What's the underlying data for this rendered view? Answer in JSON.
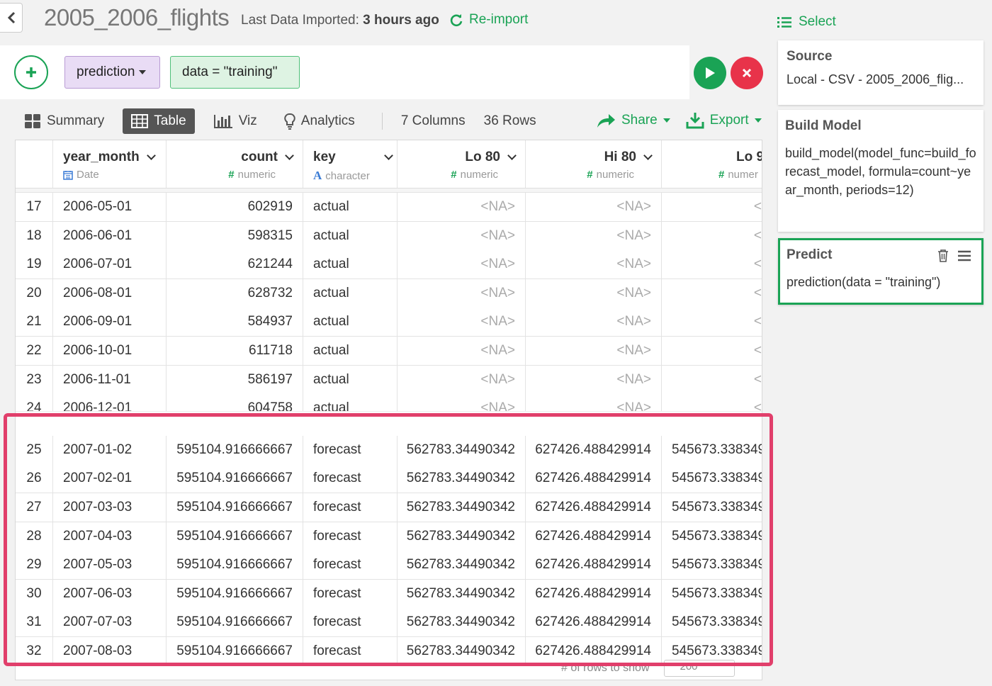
{
  "header": {
    "title": "2005_2006_flights",
    "last_imported_label": "Last Data Imported:",
    "last_imported_value": "3 hours ago",
    "reimport_label": "Re-import"
  },
  "step": {
    "function_token": "prediction",
    "argument_token": "data = \"training\""
  },
  "tabs": [
    {
      "label": "Summary"
    },
    {
      "label": "Table"
    },
    {
      "label": "Viz"
    },
    {
      "label": "Analytics"
    }
  ],
  "table_info": {
    "columns": "7 Columns",
    "rows": "36 Rows"
  },
  "actions": {
    "share": "Share",
    "export": "Export"
  },
  "table": {
    "columns": [
      {
        "name": "year_month",
        "type": "Date"
      },
      {
        "name": "count",
        "type": "numeric"
      },
      {
        "name": "key",
        "type": "character"
      },
      {
        "name": "Lo 80",
        "type": "numeric"
      },
      {
        "name": "Hi 80",
        "type": "numeric"
      },
      {
        "name": "Lo 9",
        "type": "numer"
      }
    ],
    "rows": [
      [
        "17",
        "2006-05-01",
        "602919",
        "actual",
        "<NA>",
        "<NA>",
        "<"
      ],
      [
        "18",
        "2006-06-01",
        "598315",
        "actual",
        "<NA>",
        "<NA>",
        "<"
      ],
      [
        "19",
        "2006-07-01",
        "621244",
        "actual",
        "<NA>",
        "<NA>",
        "<"
      ],
      [
        "20",
        "2006-08-01",
        "628732",
        "actual",
        "<NA>",
        "<NA>",
        "<"
      ],
      [
        "21",
        "2006-09-01",
        "584937",
        "actual",
        "<NA>",
        "<NA>",
        "<"
      ],
      [
        "22",
        "2006-10-01",
        "611718",
        "actual",
        "<NA>",
        "<NA>",
        "<"
      ],
      [
        "23",
        "2006-11-01",
        "586197",
        "actual",
        "<NA>",
        "<NA>",
        "<"
      ],
      [
        "24",
        "2006-12-01",
        "604758",
        "actual",
        "<NA>",
        "<NA>",
        "<"
      ],
      [
        "25",
        "2007-01-02",
        "595104.916666667",
        "forecast",
        "562783.34490342",
        "627426.488429914",
        "545673.338349"
      ],
      [
        "26",
        "2007-02-01",
        "595104.916666667",
        "forecast",
        "562783.34490342",
        "627426.488429914",
        "545673.338349"
      ],
      [
        "27",
        "2007-03-03",
        "595104.916666667",
        "forecast",
        "562783.34490342",
        "627426.488429914",
        "545673.338349"
      ],
      [
        "28",
        "2007-04-03",
        "595104.916666667",
        "forecast",
        "562783.34490342",
        "627426.488429914",
        "545673.338349"
      ],
      [
        "29",
        "2007-05-03",
        "595104.916666667",
        "forecast",
        "562783.34490342",
        "627426.488429914",
        "545673.338349"
      ],
      [
        "30",
        "2007-06-03",
        "595104.916666667",
        "forecast",
        "562783.34490342",
        "627426.488429914",
        "545673.338349"
      ],
      [
        "31",
        "2007-07-03",
        "595104.916666667",
        "forecast",
        "562783.34490342",
        "627426.488429914",
        "545673.338349"
      ],
      [
        "32",
        "2007-08-03",
        "595104.916666667",
        "forecast",
        "562783.34490342",
        "627426.488429914",
        "545673.338349"
      ]
    ],
    "footer_label": "# of rows to show",
    "rows_to_show": "200"
  },
  "sidebar": {
    "select_label": "Select",
    "source": {
      "title": "Source",
      "body": "Local - CSV - 2005_2006_flig..."
    },
    "build_model": {
      "title": "Build Model",
      "body": "build_model(model_func=build_forecast_model, formula=count~year_month, periods=12)"
    },
    "predict": {
      "title": "Predict",
      "body": "prediction(data = \"training\")"
    }
  },
  "colors": {
    "accent": "#1aa355",
    "danger": "#e8334a",
    "highlight": "#e13f6b",
    "func_token": "#e9dcf5",
    "arg_token": "#def3e3"
  }
}
